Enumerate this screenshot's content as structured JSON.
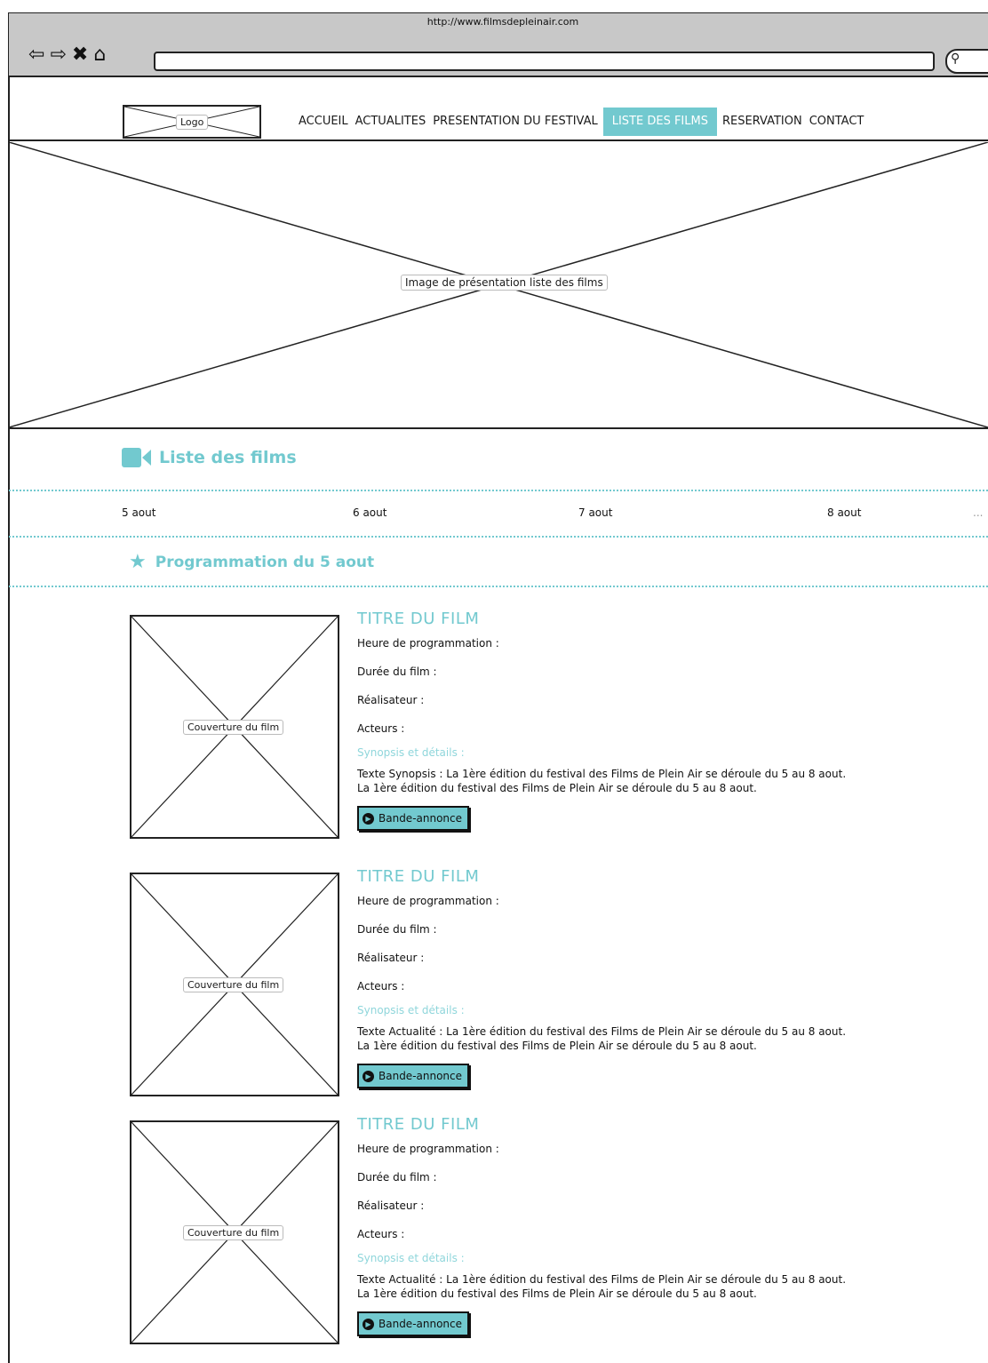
{
  "browser": {
    "url": "http://www.filmsdepleinair.com",
    "icons": [
      "back-arrow-icon",
      "forward-arrow-icon",
      "close-icon",
      "home-icon",
      "search-icon"
    ]
  },
  "header": {
    "logo_label": "Logo",
    "menu": [
      {
        "label": "ACCUEIL",
        "active": false
      },
      {
        "label": "ACTUALITES",
        "active": false
      },
      {
        "label": "PRESENTATION DU FESTIVAL",
        "active": false
      },
      {
        "label": "LISTE DES FILMS",
        "active": true
      },
      {
        "label": "RESERVATION",
        "active": false
      },
      {
        "label": "CONTACT",
        "active": false
      }
    ]
  },
  "hero": {
    "label": "Image de présentation liste des films"
  },
  "section": {
    "title": "Liste des films",
    "icon": "video-camera-icon"
  },
  "days": [
    "5 aout",
    "6 aout",
    "7 aout",
    "8 aout",
    "..."
  ],
  "programme": {
    "title": "Programmation du 5 aout",
    "icon": "star-icon"
  },
  "films": [
    {
      "cover_label": "Couverture du film",
      "title": "TITRE DU FILM",
      "time": "Heure de programmation :",
      "duration": "Durée du film :",
      "director": "Réalisateur :",
      "actors": "Acteurs :",
      "synopsis_label": "Synopsis et détails :",
      "synopsis_line1": "Texte Synopsis : La 1ère édition du festival des Films de Plein Air se déroule du 5 au 8 aout.",
      "synopsis_line2": "La 1ère édition du festival des Films de Plein Air se déroule du 5 au 8 aout.",
      "trailer_label": "Bande-annonce"
    },
    {
      "cover_label": "Couverture du film",
      "title": "TITRE DU FILM",
      "time": "Heure de programmation :",
      "duration": "Durée du film :",
      "director": "Réalisateur :",
      "actors": "Acteurs :",
      "synopsis_label": "Synopsis et détails :",
      "synopsis_line1": "Texte Actualité : La 1ère édition du festival des Films de Plein Air se déroule du 5 au 8 aout.",
      "synopsis_line2": "La 1ère édition du festival des Films de Plein Air se déroule du 5 au 8 aout.",
      "trailer_label": "Bande-annonce"
    },
    {
      "cover_label": "Couverture du film",
      "title": "TITRE DU FILM",
      "time": "Heure de programmation :",
      "duration": "Durée du film :",
      "director": "Réalisateur :",
      "actors": "Acteurs :",
      "synopsis_label": "Synopsis et détails :",
      "synopsis_line1": "Texte Actualité : La 1ère édition du festival des Films de Plein Air se déroule du 5 au 8 aout.",
      "synopsis_line2": "La 1ère édition du festival des Films de Plein Air se déroule du 5 au 8 aout.",
      "trailer_label": "Bande-annonce"
    }
  ]
}
